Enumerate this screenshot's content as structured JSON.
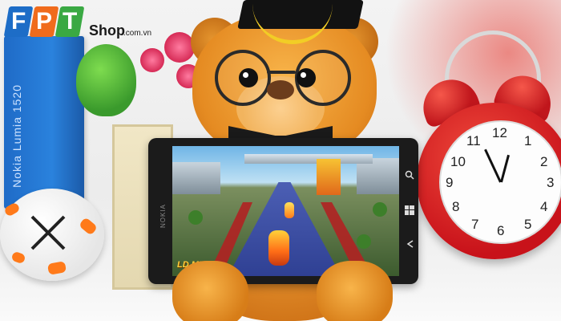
{
  "logo": {
    "letters": [
      "F",
      "P",
      "T"
    ],
    "tile_colors": [
      "#1d6dc7",
      "#f06b1c",
      "#3aa943"
    ],
    "shop_label": "Shop",
    "domain_label": ".com.vn"
  },
  "background_box": {
    "text": "Nokia Lumia 1520"
  },
  "phone": {
    "brand": "NOKIA",
    "game_publisher": "LD MEDIA",
    "buttons": [
      "search-icon",
      "windows-icon",
      "back-icon"
    ]
  },
  "clock": {
    "numbers": [
      "12",
      "1",
      "2",
      "3",
      "4",
      "5",
      "6",
      "7",
      "8",
      "9",
      "10",
      "11"
    ]
  },
  "colors": {
    "bear_fur": "#f0a03a",
    "clock_red": "#d8201f",
    "road_blue": "#3a4ea6"
  }
}
